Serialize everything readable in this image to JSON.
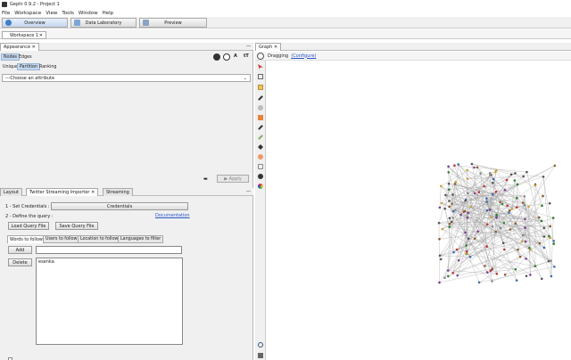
{
  "window": {
    "title": "Gephi 0.9.2 - Project 1"
  },
  "menu": {
    "items": [
      "File",
      "Workspace",
      "View",
      "Tools",
      "Window",
      "Help"
    ]
  },
  "nav": {
    "overview": "Overview",
    "data_lab": "Data Laboratory",
    "preview": "Preview"
  },
  "workspace": {
    "tab": "Workspace 1"
  },
  "appearance": {
    "tab": "Appearance",
    "nodes": "Nodes",
    "edges": "Edges",
    "unique": "Unique",
    "partition": "Partition",
    "ranking": "Ranking",
    "select_placeholder": "---Choose an attribute",
    "apply": "Apply"
  },
  "bottom_tabs": {
    "layout": "Layout",
    "twitter": "Twitter Streaming Importer",
    "streaming": "Streaming"
  },
  "twitter": {
    "set_credentials": "1 - Set Credentials :",
    "credentials_btn": "Credentials",
    "define_query": "2 - Define the query :",
    "documentation": "Documentation",
    "load_query": "Load Query File",
    "save_query": "Save Query File",
    "tabs": [
      "Words to follow",
      "Users to follow",
      "Location to follow",
      "Languages to filter"
    ],
    "add": "Add",
    "delete": "Delete",
    "words": [
      "esenka"
    ]
  },
  "graph": {
    "tab": "Graph",
    "dragging": "Dragging",
    "configure": "(Configure)"
  },
  "colors": {
    "accent": "#c6d8ef",
    "link": "#2a55c7"
  }
}
